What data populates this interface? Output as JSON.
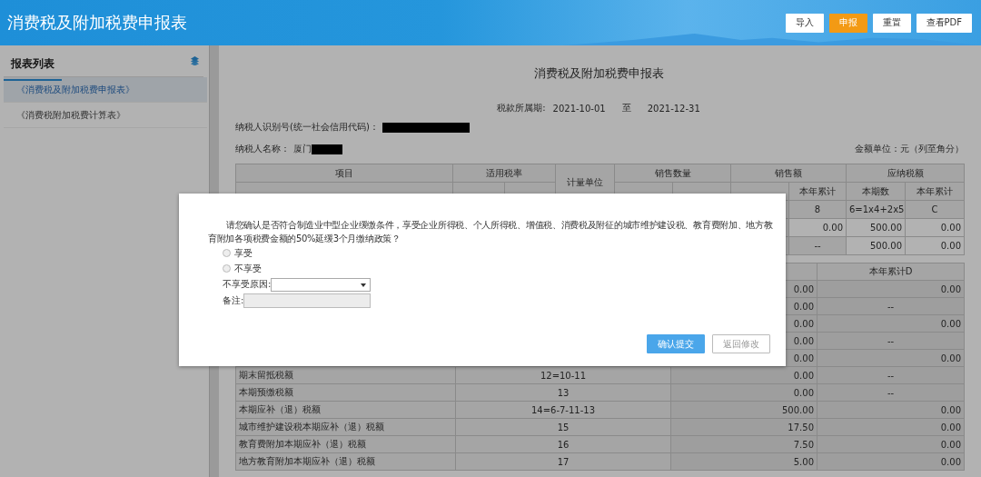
{
  "header": {
    "title": "消费税及附加税费申报表",
    "buttons": [
      {
        "label": "导入",
        "kind": "default"
      },
      {
        "label": "申报",
        "kind": "primary"
      },
      {
        "label": "重置",
        "kind": "default"
      },
      {
        "label": "查看PDF",
        "kind": "default"
      }
    ]
  },
  "sidebar": {
    "title": "报表列表",
    "items": [
      {
        "label": "《消费税及附加税费申报表》",
        "selected": true
      },
      {
        "label": "《消费税附加税费计算表》",
        "selected": false
      }
    ]
  },
  "report": {
    "title": "消费税及附加税费申报表",
    "period_label": "税款所属期:",
    "period_start": "2021-10-01",
    "period_sep": "至",
    "period_end": "2021-12-31",
    "taxpayer_id_label": "纳税人识别号(统一社会信用代码)：",
    "taxpayer_name_label": "纳税人名称：",
    "taxpayer_name": "厦门",
    "unit_note": "金额单位：元（列至角分）"
  },
  "table_1": {
    "header_row_1": [
      "项目",
      "适用税率",
      "计量单位",
      "销售数量",
      "销售额",
      "应纳税额"
    ],
    "header_row_2": {
      "column_8": "本年累计",
      "column_9": "本期数",
      "column_10": "本年累计"
    },
    "rows": [
      {
        "column_8": "8",
        "column_9": "6=1x4+2x5",
        "column_10": "C"
      },
      {
        "column_8": "0.00",
        "column_9": "500.00",
        "column_10": "0.00"
      },
      {
        "column_8": "--",
        "column_9": "500.00",
        "column_10": "0.00"
      }
    ]
  },
  "table_2": {
    "header": {
      "column_4": "本年累计D"
    },
    "rows": [
      {
        "column_3": "0.00",
        "column_4": "0.00"
      },
      {
        "column_3": "0.00",
        "column_4": "--"
      },
      {
        "column_3": "0.00",
        "column_4": "0.00"
      },
      {
        "column_3": "0.00",
        "column_4": "--"
      },
      {
        "column_3": "0.00",
        "column_4": "0.00"
      },
      {
        "column_1": "期末留抵税额",
        "column_2": "12=10-11",
        "column_3": "0.00",
        "column_4": "--"
      },
      {
        "column_1": "本期预缴税额",
        "column_2": "13",
        "column_3": "0.00",
        "column_4": "--"
      },
      {
        "column_1": "本期应补（退）税额",
        "column_2": "14=6-7-11-13",
        "column_3": "500.00",
        "column_4": "0.00"
      },
      {
        "column_1": "城市维护建设税本期应补（退）税额",
        "column_2": "15",
        "column_3": "17.50",
        "column_4": "0.00"
      },
      {
        "column_1": "教育费附加本期应补（退）税额",
        "column_2": "16",
        "column_3": "7.50",
        "column_4": "0.00"
      },
      {
        "column_1": "地方教育附加本期应补（退）税额",
        "column_2": "17",
        "column_3": "5.00",
        "column_4": "0.00"
      }
    ]
  },
  "dialog": {
    "message": "请您确认是否符合制造业中型企业缓缴条件，享受企业所得税、个人所得税、增值税、消费税及附征的城市维护建设税、教育费附加、地方教育附加各项税费金额的50%延缓3个月缴纳政策？",
    "options": [
      {
        "label": "享受",
        "selected": false
      },
      {
        "label": "不享受",
        "selected": false
      }
    ],
    "reason_label": "不享受原因:",
    "remark_label": "备注:",
    "remark_disabled": true,
    "buttons": [
      {
        "label": "确认提交",
        "kind": "primary"
      },
      {
        "label": "返回修改",
        "kind": "default"
      }
    ]
  }
}
